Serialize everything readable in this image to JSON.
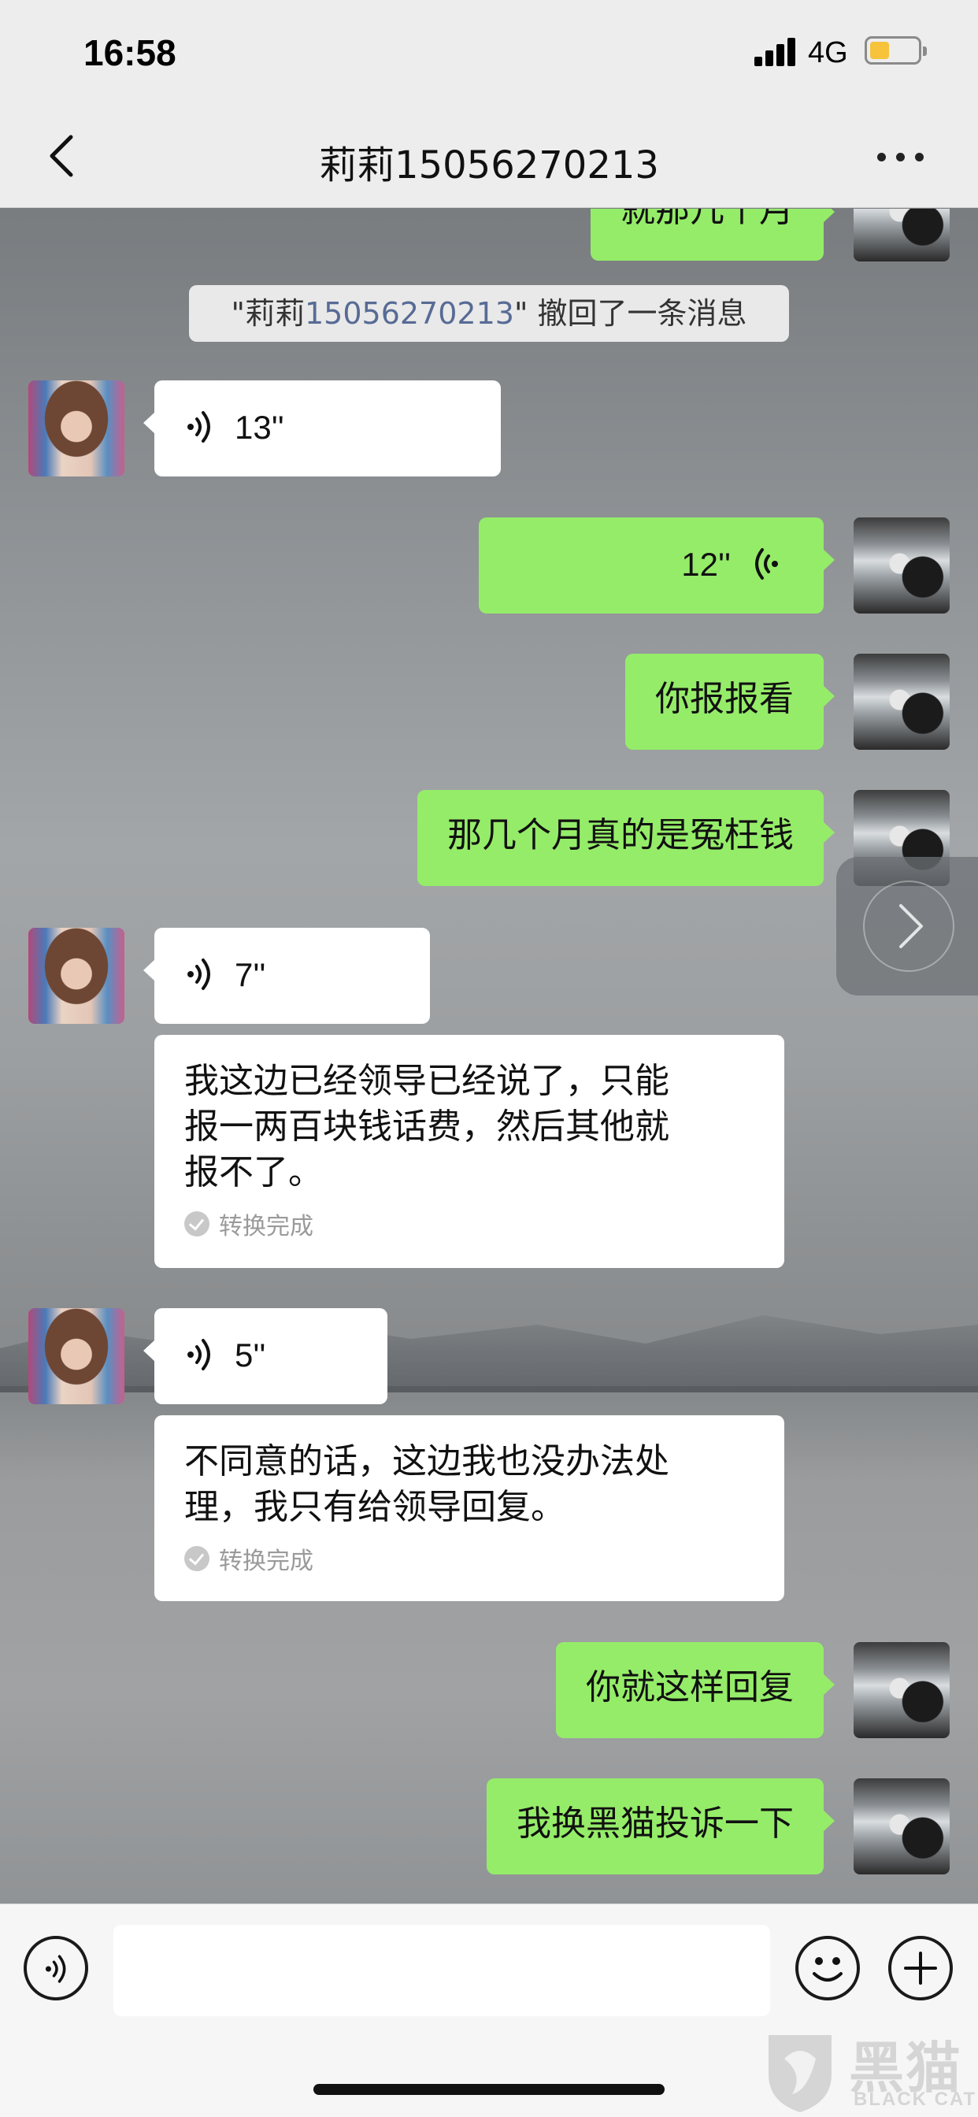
{
  "status_bar": {
    "time": "16:58",
    "network": "4G",
    "battery_color": "#f6c33b"
  },
  "header": {
    "title": "莉莉15056270213",
    "back_icon": "chevron-left-icon",
    "more_icon": "more-dots-icon"
  },
  "chat": {
    "partial_top_message": "就那几个月",
    "recall_notice": {
      "prefix": "\"莉莉",
      "number": "15056270213",
      "suffix": "\" 撤回了一条消息"
    },
    "voice_1": {
      "duration": "13''"
    },
    "voice_2": {
      "duration": "12''"
    },
    "msg_out_1": "你报报看",
    "msg_out_2": "那几个月真的是冤枉钱",
    "voice_3": {
      "duration": "7''"
    },
    "transcript_1": {
      "lines": [
        "我这边已经领导已经说了，只能",
        "报一两百块钱话费，然后其他就",
        "报不了。"
      ],
      "status": "转换完成"
    },
    "voice_4": {
      "duration": "5''"
    },
    "transcript_2": {
      "lines": [
        "不同意的话，这边我也没办法处",
        "理，我只有给领导回复。"
      ],
      "status": "转换完成"
    },
    "msg_out_3": "你就这样回复",
    "msg_out_4": "我换黑猫投诉一下"
  },
  "colors": {
    "outgoing_bubble": "#95ec69",
    "incoming_bubble": "#ffffff",
    "link_number": "#576b95"
  },
  "toolbar": {
    "voice_icon": "voice-toggle-icon",
    "emoji_icon": "emoji-icon",
    "plus_icon": "plus-icon",
    "input_value": ""
  },
  "watermark": {
    "name": "黑猫",
    "sub": "BLACK CAT"
  }
}
